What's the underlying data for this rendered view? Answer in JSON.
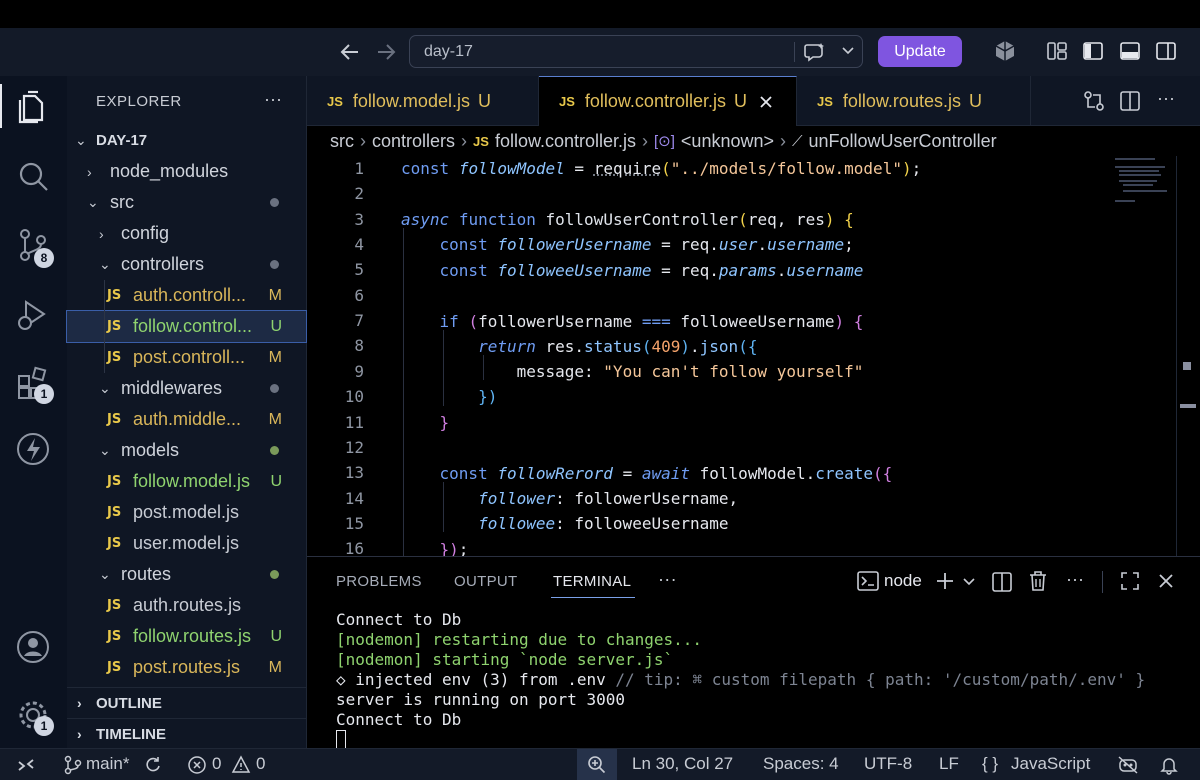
{
  "titlebar": {
    "search_text": "day-17",
    "update_label": "Update"
  },
  "activity": {
    "source_control_badge": "8",
    "extensions_badge": "1",
    "settings_badge": "1"
  },
  "sidebar": {
    "title": "EXPLORER",
    "more": "···",
    "project": "DAY-17",
    "tree": [
      {
        "label": "node_modules",
        "kind": "folder",
        "open": false,
        "depth": 1
      },
      {
        "label": "src",
        "kind": "folder",
        "open": true,
        "depth": 1,
        "dot": true
      },
      {
        "label": "config",
        "kind": "folder",
        "open": false,
        "depth": 2
      },
      {
        "label": "controllers",
        "kind": "folder",
        "open": true,
        "depth": 2,
        "dot": true
      },
      {
        "label": "auth.controll...",
        "kind": "file",
        "depth": 3,
        "flag": "M"
      },
      {
        "label": "follow.control...",
        "kind": "file",
        "depth": 3,
        "flag": "U",
        "selected": true
      },
      {
        "label": "post.controll...",
        "kind": "file",
        "depth": 3,
        "flag": "M"
      },
      {
        "label": "middlewares",
        "kind": "folder",
        "open": true,
        "depth": 2,
        "dot": true
      },
      {
        "label": "auth.middle...",
        "kind": "file",
        "depth": 3,
        "flag": "M"
      },
      {
        "label": "models",
        "kind": "folder",
        "open": true,
        "depth": 2,
        "dot": true,
        "dot_green": true
      },
      {
        "label": "follow.model.js",
        "kind": "file",
        "depth": 3,
        "flag": "U"
      },
      {
        "label": "post.model.js",
        "kind": "file",
        "depth": 3
      },
      {
        "label": "user.model.js",
        "kind": "file",
        "depth": 3
      },
      {
        "label": "routes",
        "kind": "folder",
        "open": true,
        "depth": 2,
        "dot": true,
        "dot_green": true
      },
      {
        "label": "auth.routes.js",
        "kind": "file",
        "depth": 3
      },
      {
        "label": "follow.routes.js",
        "kind": "file",
        "depth": 3,
        "flag": "U"
      },
      {
        "label": "post.routes.js",
        "kind": "file",
        "depth": 3,
        "flag": "M"
      }
    ],
    "outline": "OUTLINE",
    "timeline": "TIMELINE"
  },
  "tabs": [
    {
      "icon": "JS",
      "label": "follow.model.js",
      "flag": "U"
    },
    {
      "icon": "JS",
      "label": "follow.controller.js",
      "flag": "U",
      "active": true
    },
    {
      "icon": "JS",
      "label": "follow.routes.js",
      "flag": "U"
    }
  ],
  "breadcrumb": [
    "src",
    "controllers",
    "follow.controller.js",
    "<unknown>",
    "unFollowUserController"
  ],
  "editor": {
    "line_numbers": [
      "1",
      "2",
      "3",
      "4",
      "5",
      "6",
      "7",
      "8",
      "9",
      "10",
      "11",
      "12",
      "13",
      "14",
      "15",
      "16"
    ]
  },
  "panel": {
    "tabs": [
      "PROBLEMS",
      "OUTPUT",
      "TERMINAL"
    ],
    "active_tab": "TERMINAL",
    "more": "···",
    "shell": "node",
    "terminal_lines": [
      "Connect to Db",
      "[nodemon] restarting due to changes...",
      "[nodemon] starting `node server.js`",
      "◇ injected env (3) from .env",
      "// tip: ⌘ custom filepath { path: '/custom/path/.env' }",
      "server is running on port 3000",
      "Connect to Db"
    ]
  },
  "statusbar": {
    "branch": "main*",
    "errors": "0",
    "warnings": "0",
    "position": "Ln 30, Col 27",
    "spaces": "Spaces: 4",
    "encoding": "UTF-8",
    "eol": "LF",
    "language_braces": "{ }",
    "language": "JavaScript"
  },
  "colors": {
    "accent": "#7f55e0",
    "js_icon": "#e8c84a",
    "modified": "#d9b65a",
    "untracked": "#8fd36f"
  }
}
